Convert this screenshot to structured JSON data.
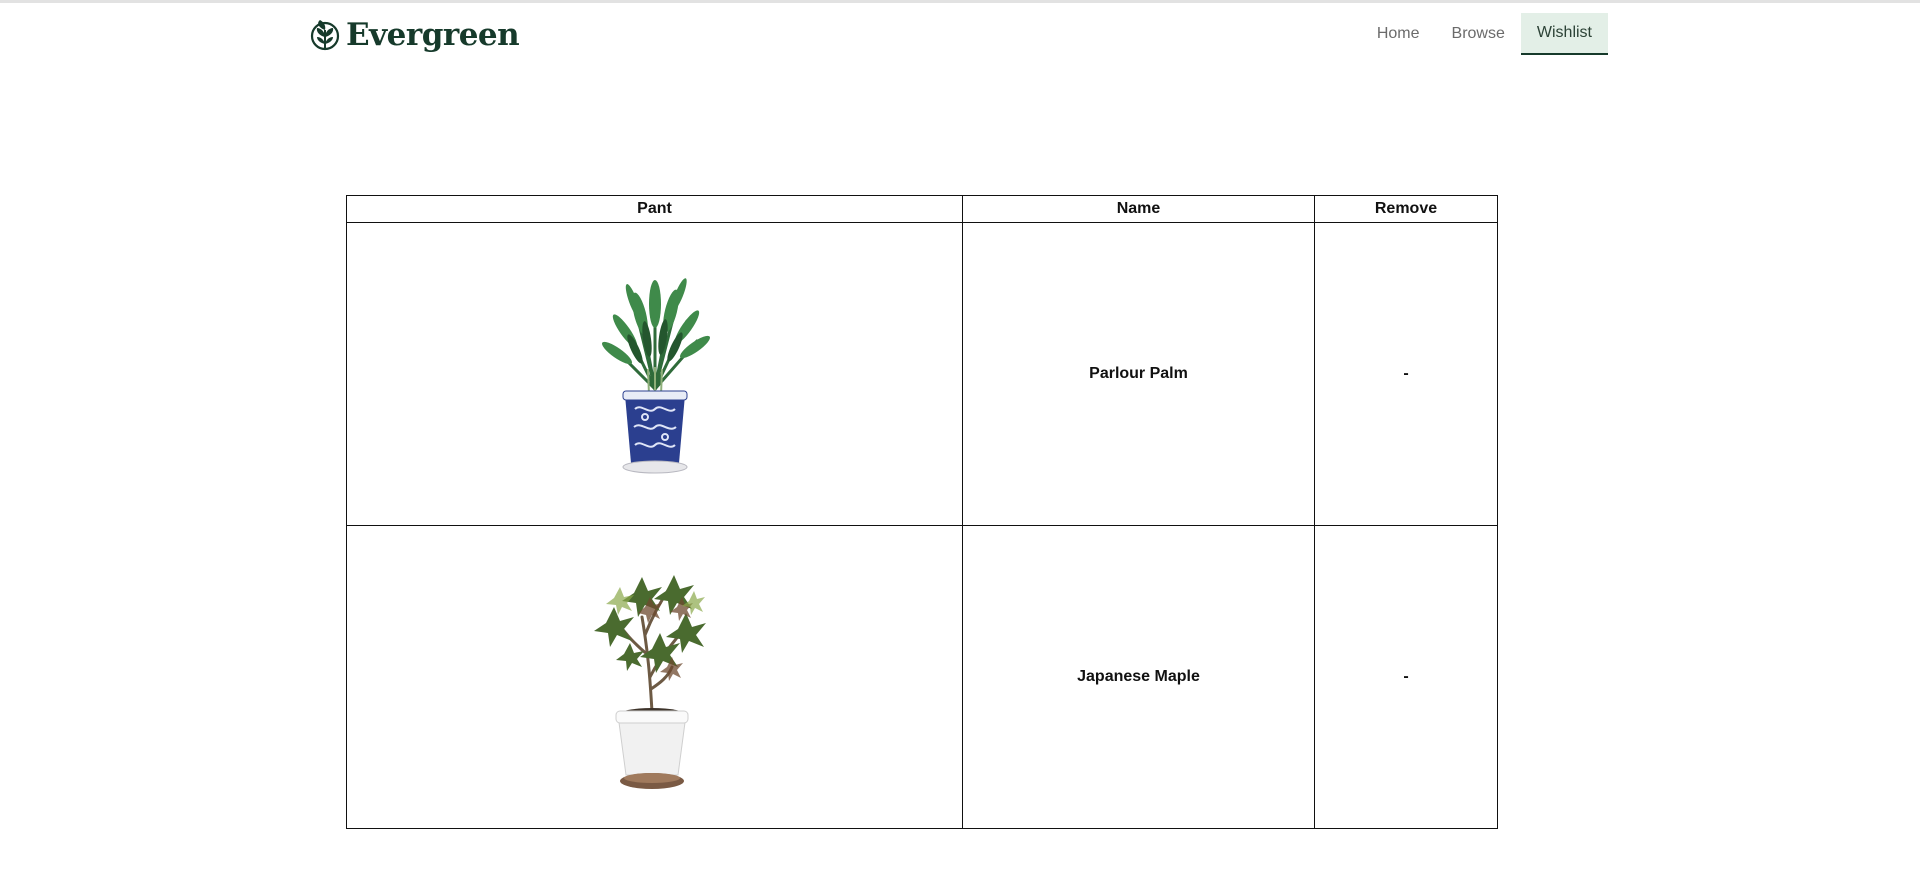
{
  "brand": {
    "name": "Evergreen",
    "color": "#163a2b"
  },
  "nav": {
    "items": [
      {
        "label": "Home",
        "active": false
      },
      {
        "label": "Browse",
        "active": false
      },
      {
        "label": "Wishlist",
        "active": true
      }
    ],
    "active_bg": "#e3efe7"
  },
  "table": {
    "headers": [
      "Pant",
      "Name",
      "Remove"
    ],
    "rows": [
      {
        "image": "parlour-palm-image",
        "name": "Parlour Palm",
        "remove": "-"
      },
      {
        "image": "japanese-maple-image",
        "name": "Japanese Maple",
        "remove": "-"
      }
    ]
  }
}
